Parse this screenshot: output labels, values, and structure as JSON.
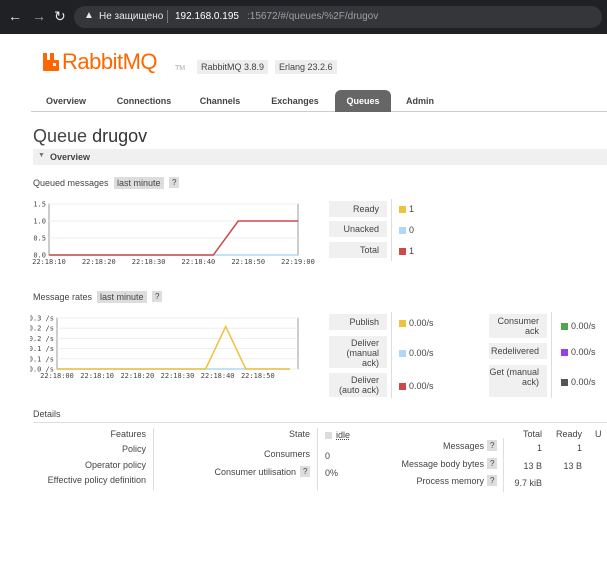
{
  "browser": {
    "insecure_label": "Не защищено",
    "url_host": "192.168.0.195",
    "url_path": ":15672/#/queues/%2F/drugov"
  },
  "header": {
    "logo_text": "RabbitMQ",
    "logo_tm": "TM",
    "version": "RabbitMQ 3.8.9",
    "erlang": "Erlang 23.2.6",
    "brand_color": "#ff6600"
  },
  "tabs": [
    {
      "label": "Overview"
    },
    {
      "label": "Connections"
    },
    {
      "label": "Channels"
    },
    {
      "label": "Exchanges"
    },
    {
      "label": "Queues",
      "active": true
    },
    {
      "label": "Admin"
    }
  ],
  "page": {
    "title_prefix": "Queue",
    "queue_name": "drugov",
    "overview_label": "Overview"
  },
  "queued": {
    "label": "Queued messages",
    "range": "last minute",
    "help": "?",
    "legend": [
      {
        "label": "Ready",
        "value": "1",
        "color": "#edc240"
      },
      {
        "label": "Unacked",
        "value": "0",
        "color": "#afd8f8"
      },
      {
        "label": "Total",
        "value": "1",
        "color": "#cb4b4b"
      }
    ]
  },
  "rates": {
    "label": "Message rates",
    "range": "last minute",
    "help": "?",
    "legend_left": [
      {
        "label": "Publish",
        "value": "0.00/s",
        "color": "#edc240"
      },
      {
        "label": "Deliver (manual ack)",
        "value": "0.00/s",
        "color": "#afd8f8"
      },
      {
        "label": "Deliver (auto ack)",
        "value": "0.00/s",
        "color": "#cb4b4b"
      }
    ],
    "legend_right": [
      {
        "label": "Consumer ack",
        "value": "0.00/s",
        "color": "#4da74d"
      },
      {
        "label": "Redelivered",
        "value": "0.00/s",
        "color": "#9440ed"
      },
      {
        "label": "Get (manual ack)",
        "value": "0.00/s",
        "color": "#555555"
      }
    ]
  },
  "details": {
    "label": "Details",
    "features_label": "Features",
    "policy_label": "Policy",
    "operator_policy_label": "Operator policy",
    "effective_policy_label": "Effective policy definition",
    "state_label": "State",
    "state_value": "idle",
    "consumers_label": "Consumers",
    "consumers_value": "0",
    "consumer_util_label": "Consumer utilisation",
    "consumer_util_value": "0%",
    "help": "?",
    "col_total": "Total",
    "col_ready": "Ready",
    "col_unacked": "U",
    "messages_label": "Messages",
    "messages_total": "1",
    "messages_ready": "1",
    "body_bytes_label": "Message body bytes",
    "body_bytes_total": "13 B",
    "body_bytes_ready": "13 B",
    "process_memory_label": "Process memory",
    "process_memory_value": "9.7 kiB"
  },
  "chart_data": [
    {
      "type": "line",
      "title": "Queued messages",
      "x": [
        "22:18:10",
        "22:18:20",
        "22:18:30",
        "22:18:40",
        "22:18:50",
        "22:19:00"
      ],
      "yticks": [
        "0.0",
        "0.5",
        "1.0",
        "1.5"
      ],
      "ylim": [
        0,
        1.5
      ],
      "series": [
        {
          "name": "Total",
          "color": "#cb4b4b",
          "points": [
            [
              0,
              0
            ],
            [
              3.3,
              0
            ],
            [
              3.8,
              1
            ],
            [
              5,
              1
            ]
          ]
        },
        {
          "name": "Unacked",
          "color": "#afd8f8",
          "points": [
            [
              0,
              0
            ],
            [
              5,
              0
            ]
          ]
        }
      ]
    },
    {
      "type": "line",
      "title": "Message rates",
      "x": [
        "22:18:00",
        "22:18:10",
        "22:18:20",
        "22:18:30",
        "22:18:40",
        "22:18:50"
      ],
      "yticks": [
        "0.0 /s",
        "0.1 /s",
        "0.1 /s",
        "0.2 /s",
        "0.2 /s",
        "0.3 /s"
      ],
      "ylim": [
        0,
        0.3
      ],
      "series": [
        {
          "name": "Publish",
          "color": "#edc240",
          "points": [
            [
              0,
              0
            ],
            [
              3.7,
              0
            ],
            [
              4.2,
              0.25
            ],
            [
              4.7,
              0
            ],
            [
              5.8,
              0
            ]
          ]
        },
        {
          "name": "Deliver (manual ack)",
          "color": "#afd8f8",
          "points": [
            [
              0,
              0
            ],
            [
              5.8,
              0
            ]
          ]
        }
      ]
    }
  ]
}
